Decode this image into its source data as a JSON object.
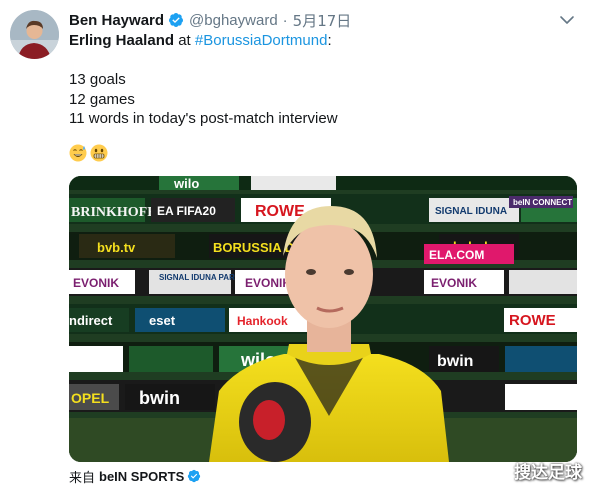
{
  "tweet": {
    "author_name": "Ben Hayward",
    "handle": "@bghayward",
    "separator": "·",
    "date": "5月17日",
    "text_line1_bold": "Erling Haaland",
    "text_line1_mid": " at ",
    "text_line1_hashtag": "#BorussiaDortmund",
    "text_line1_end": ":",
    "text_lines": [
      "13 goals",
      "12 games",
      "11 words in today's post-match interview"
    ],
    "emojis": [
      "grinning-sweat-emoji",
      "grimacing-emoji"
    ]
  },
  "media": {
    "boards": [
      "wilo",
      "BRINKHOFF'S",
      "EA FIFA20",
      "ROWE",
      "SIGNAL IDUNA",
      "bvb.tv",
      "BORUSSIA D",
      "EVONIK",
      "SIGNAL IDUNA PARK",
      "eset",
      "Hankook",
      "bwin",
      "OPEL",
      "ndirect",
      "ELA.COM",
      "bvb.de"
    ],
    "broadcaster_bug": "beIN CONNECT"
  },
  "source": {
    "via": "来自",
    "name": "beIN SPORTS"
  },
  "watermark": "搜达足球",
  "colors": {
    "hashtag": "#1b95e0",
    "verified": "#1da1f2",
    "secondary_text": "#657786"
  }
}
